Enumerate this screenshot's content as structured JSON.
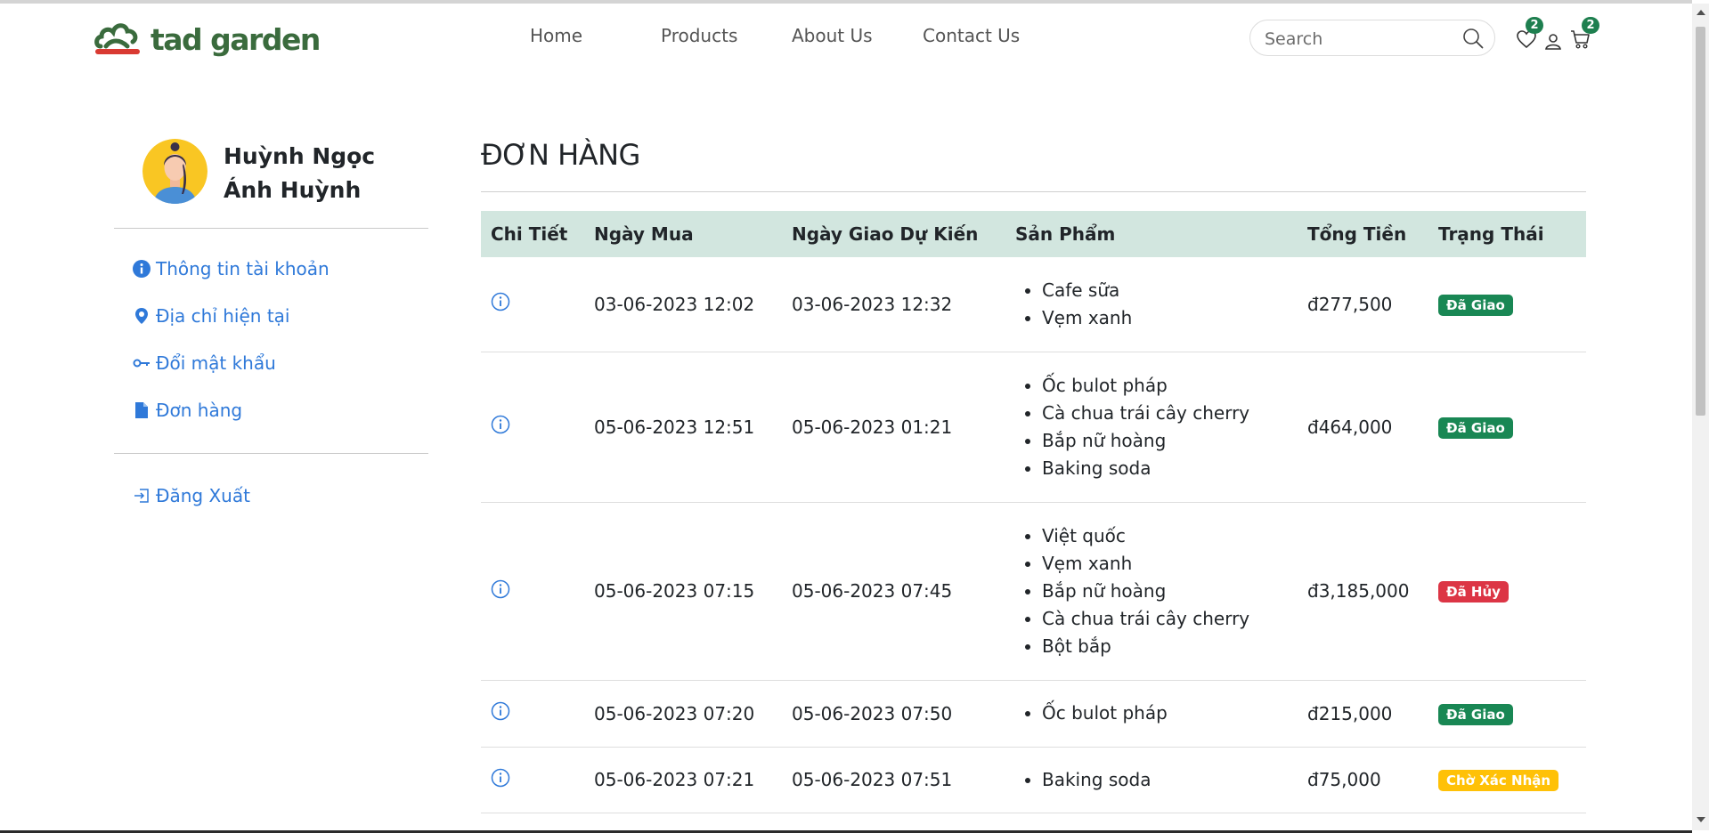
{
  "header": {
    "brand": "tad garden",
    "nav": [
      {
        "label": "Home"
      },
      {
        "label": "Products"
      },
      {
        "label": "About Us"
      },
      {
        "label": "Contact Us"
      }
    ],
    "search_placeholder": "Search",
    "wishlist_count": "2",
    "cart_count": "2",
    "icons": [
      "search-icon",
      "heart-icon",
      "user-icon",
      "cart-icon"
    ]
  },
  "sidebar": {
    "user_name": "Huỳnh Ngọc Ánh Huỳnh",
    "items": [
      {
        "label": "Thông tin tài khoản",
        "icon": "info-circle-icon"
      },
      {
        "label": "Địa chỉ hiện tại",
        "icon": "map-pin-icon"
      },
      {
        "label": "Đổi mật khẩu",
        "icon": "key-icon"
      },
      {
        "label": "Đơn hàng",
        "icon": "document-icon"
      }
    ],
    "logout_label": "Đăng Xuất"
  },
  "main": {
    "title": "ĐƠN HÀNG",
    "columns": [
      "Chi Tiết",
      "Ngày Mua",
      "Ngày Giao Dự Kiến",
      "Sản Phẩm",
      "Tổng Tiền",
      "Trạng Thái"
    ],
    "orders": [
      {
        "purchase_date": "03-06-2023 12:02",
        "delivery_date": "03-06-2023 12:32",
        "products": [
          "Cafe sữa",
          "Vẹm xanh"
        ],
        "total": "đ277,500",
        "status": "Đã Giao",
        "status_color": "#198754"
      },
      {
        "purchase_date": "05-06-2023 12:51",
        "delivery_date": "05-06-2023 01:21",
        "products": [
          "Ốc bulot pháp",
          "Cà chua trái cây cherry",
          "Bắp nữ hoàng",
          "Baking soda"
        ],
        "total": "đ464,000",
        "status": "Đã Giao",
        "status_color": "#198754"
      },
      {
        "purchase_date": "05-06-2023 07:15",
        "delivery_date": "05-06-2023 07:45",
        "products": [
          "Việt quốc",
          "Vẹm xanh",
          "Bắp nữ hoàng",
          "Cà chua trái cây cherry",
          "Bột bắp"
        ],
        "total": "đ3,185,000",
        "status": "Đã Hủy",
        "status_color": "#dc3545"
      },
      {
        "purchase_date": "05-06-2023 07:20",
        "delivery_date": "05-06-2023 07:50",
        "products": [
          "Ốc bulot pháp"
        ],
        "total": "đ215,000",
        "status": "Đã Giao",
        "status_color": "#198754"
      },
      {
        "purchase_date": "05-06-2023 07:21",
        "delivery_date": "05-06-2023 07:51",
        "products": [
          "Baking soda"
        ],
        "total": "đ75,000",
        "status": "Chờ Xác Nhận",
        "status_color": "#ffc107"
      }
    ]
  },
  "colors": {
    "brand_green": "#3a6b3d",
    "link_blue": "#2f79d9",
    "header_row": "#d2e6df"
  }
}
